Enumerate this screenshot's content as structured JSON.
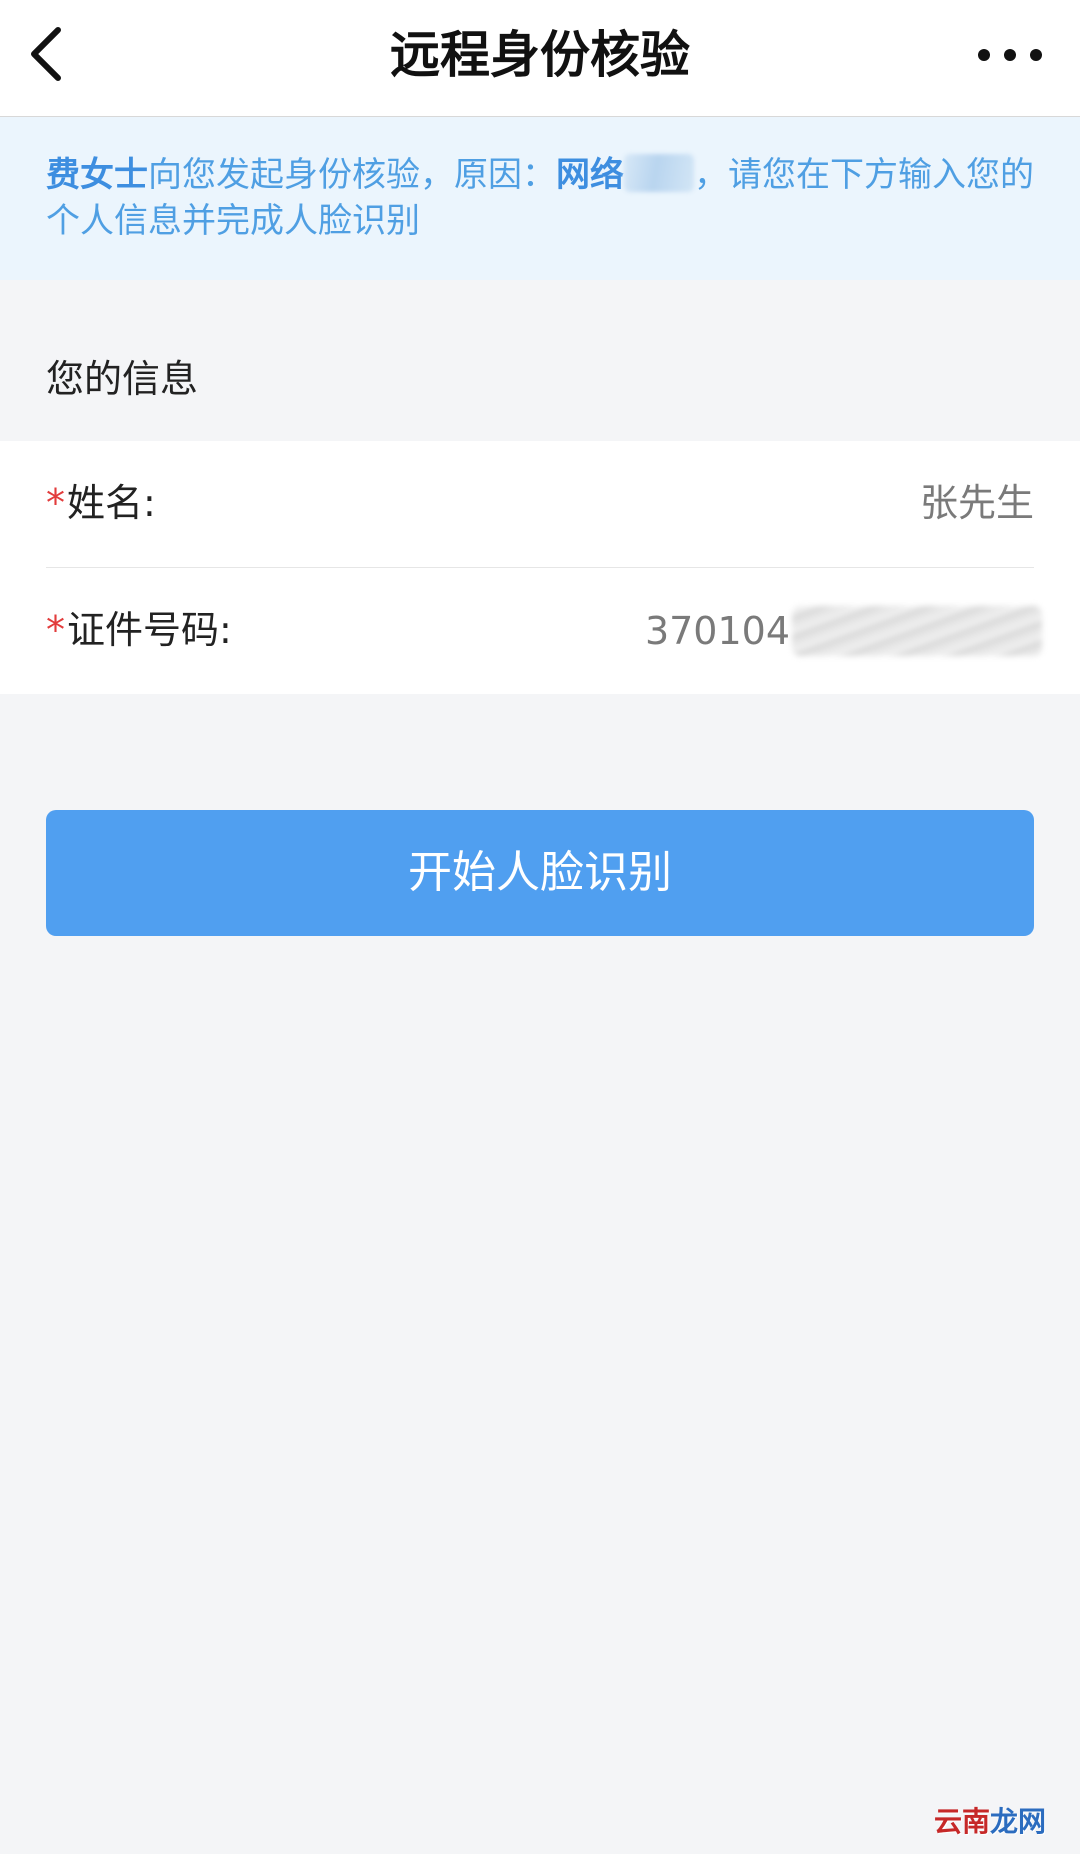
{
  "navbar": {
    "title": "远程身份核验",
    "back_icon": "chevron-left-icon",
    "more_icon": "more-dots-icon"
  },
  "notice": {
    "requester": "费女士",
    "text_1": "向您发起身份核验，原因：",
    "reason": "网络",
    "text_2": "，请您在下方输入您的个人信息并完成人脸识别"
  },
  "section": {
    "title": "您的信息"
  },
  "form": {
    "required_mark": "*",
    "name_label": "姓名:",
    "name_value": "张先生",
    "id_label": "证件号码:",
    "id_value": "370104"
  },
  "actions": {
    "start_label": "开始人脸识别"
  },
  "watermark": {
    "part_1": "云南",
    "part_2": "龙网"
  },
  "colors": {
    "primary": "#509ff0",
    "notice_bg": "#ebf5fd",
    "notice_text": "#4f9fe3",
    "required": "#e23c3c",
    "page_bg": "#f4f5f7"
  }
}
